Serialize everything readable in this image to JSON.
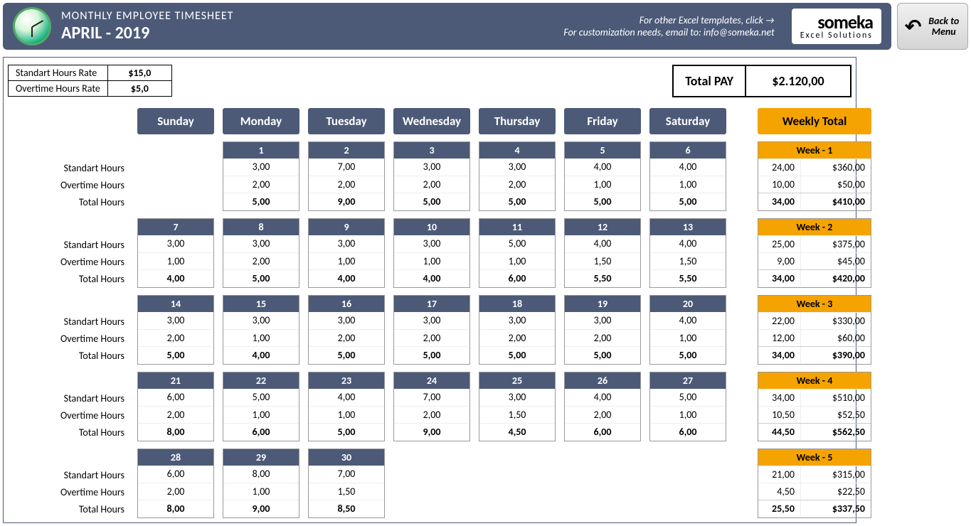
{
  "header": {
    "title_line1": "MONTHLY EMPLOYEE TIMESHEET",
    "title_line2": "APRIL - 2019",
    "promo_line1": "For other Excel templates, click →",
    "promo_line2": "For customization needs, email to: info@someka.net",
    "brand": "someka",
    "brand_sub": "Excel Solutions",
    "back_button": "Back to Menu"
  },
  "rates": {
    "std_label": "Standart Hours Rate",
    "std_value": "$15,0",
    "ot_label": "Overtime Hours Rate",
    "ot_value": "$5,0"
  },
  "total_pay": {
    "label": "Total PAY",
    "value": "$2.120,00"
  },
  "days_header": [
    "Sunday",
    "Monday",
    "Tuesday",
    "Wednesday",
    "Thursday",
    "Friday",
    "Saturday"
  ],
  "weekly_total_label": "Weekly Total",
  "row_labels": {
    "std": "Standart Hours",
    "ot": "Overtime Hours",
    "tot": "Total Hours"
  },
  "weeks": [
    {
      "name": "Week - 1",
      "days": [
        null,
        {
          "num": "1",
          "std": "3,00",
          "ot": "2,00",
          "tot": "5,00"
        },
        {
          "num": "2",
          "std": "7,00",
          "ot": "2,00",
          "tot": "9,00"
        },
        {
          "num": "3",
          "std": "3,00",
          "ot": "2,00",
          "tot": "5,00"
        },
        {
          "num": "4",
          "std": "3,00",
          "ot": "2,00",
          "tot": "5,00"
        },
        {
          "num": "5",
          "std": "4,00",
          "ot": "1,00",
          "tot": "5,00"
        },
        {
          "num": "6",
          "std": "4,00",
          "ot": "1,00",
          "tot": "5,00"
        }
      ],
      "sum": {
        "std_h": "24,00",
        "std_$": "$360,00",
        "ot_h": "10,00",
        "ot_$": "$50,00",
        "tot_h": "34,00",
        "tot_$": "$410,00"
      }
    },
    {
      "name": "Week - 2",
      "days": [
        {
          "num": "7",
          "std": "3,00",
          "ot": "1,00",
          "tot": "4,00"
        },
        {
          "num": "8",
          "std": "3,00",
          "ot": "2,00",
          "tot": "5,00"
        },
        {
          "num": "9",
          "std": "3,00",
          "ot": "1,00",
          "tot": "4,00"
        },
        {
          "num": "10",
          "std": "3,00",
          "ot": "1,00",
          "tot": "4,00"
        },
        {
          "num": "11",
          "std": "5,00",
          "ot": "1,00",
          "tot": "6,00"
        },
        {
          "num": "12",
          "std": "4,00",
          "ot": "1,50",
          "tot": "5,50"
        },
        {
          "num": "13",
          "std": "4,00",
          "ot": "1,50",
          "tot": "5,50"
        }
      ],
      "sum": {
        "std_h": "25,00",
        "std_$": "$375,00",
        "ot_h": "9,00",
        "ot_$": "$45,00",
        "tot_h": "34,00",
        "tot_$": "$420,00"
      }
    },
    {
      "name": "Week - 3",
      "days": [
        {
          "num": "14",
          "std": "3,00",
          "ot": "2,00",
          "tot": "5,00"
        },
        {
          "num": "15",
          "std": "3,00",
          "ot": "1,00",
          "tot": "4,00"
        },
        {
          "num": "16",
          "std": "3,00",
          "ot": "2,00",
          "tot": "5,00"
        },
        {
          "num": "17",
          "std": "3,00",
          "ot": "2,00",
          "tot": "5,00"
        },
        {
          "num": "18",
          "std": "3,00",
          "ot": "2,00",
          "tot": "5,00"
        },
        {
          "num": "19",
          "std": "3,00",
          "ot": "2,00",
          "tot": "5,00"
        },
        {
          "num": "20",
          "std": "4,00",
          "ot": "1,00",
          "tot": "5,00"
        }
      ],
      "sum": {
        "std_h": "22,00",
        "std_$": "$330,00",
        "ot_h": "12,00",
        "ot_$": "$60,00",
        "tot_h": "34,00",
        "tot_$": "$390,00"
      }
    },
    {
      "name": "Week - 4",
      "days": [
        {
          "num": "21",
          "std": "6,00",
          "ot": "2,00",
          "tot": "8,00"
        },
        {
          "num": "22",
          "std": "5,00",
          "ot": "1,00",
          "tot": "6,00"
        },
        {
          "num": "23",
          "std": "4,00",
          "ot": "1,00",
          "tot": "5,00"
        },
        {
          "num": "24",
          "std": "7,00",
          "ot": "2,00",
          "tot": "9,00"
        },
        {
          "num": "25",
          "std": "3,00",
          "ot": "1,50",
          "tot": "4,50"
        },
        {
          "num": "26",
          "std": "4,00",
          "ot": "2,00",
          "tot": "6,00"
        },
        {
          "num": "27",
          "std": "5,00",
          "ot": "1,00",
          "tot": "6,00"
        }
      ],
      "sum": {
        "std_h": "34,00",
        "std_$": "$510,00",
        "ot_h": "10,50",
        "ot_$": "$52,50",
        "tot_h": "44,50",
        "tot_$": "$562,50"
      }
    },
    {
      "name": "Week - 5",
      "days": [
        {
          "num": "28",
          "std": "6,00",
          "ot": "2,00",
          "tot": "8,00"
        },
        {
          "num": "29",
          "std": "8,00",
          "ot": "1,00",
          "tot": "9,00"
        },
        {
          "num": "30",
          "std": "7,00",
          "ot": "1,50",
          "tot": "8,50"
        },
        null,
        null,
        null,
        null
      ],
      "sum": {
        "std_h": "21,00",
        "std_$": "$315,00",
        "ot_h": "4,50",
        "ot_$": "$22,50",
        "tot_h": "25,50",
        "tot_$": "$337,50"
      }
    }
  ]
}
